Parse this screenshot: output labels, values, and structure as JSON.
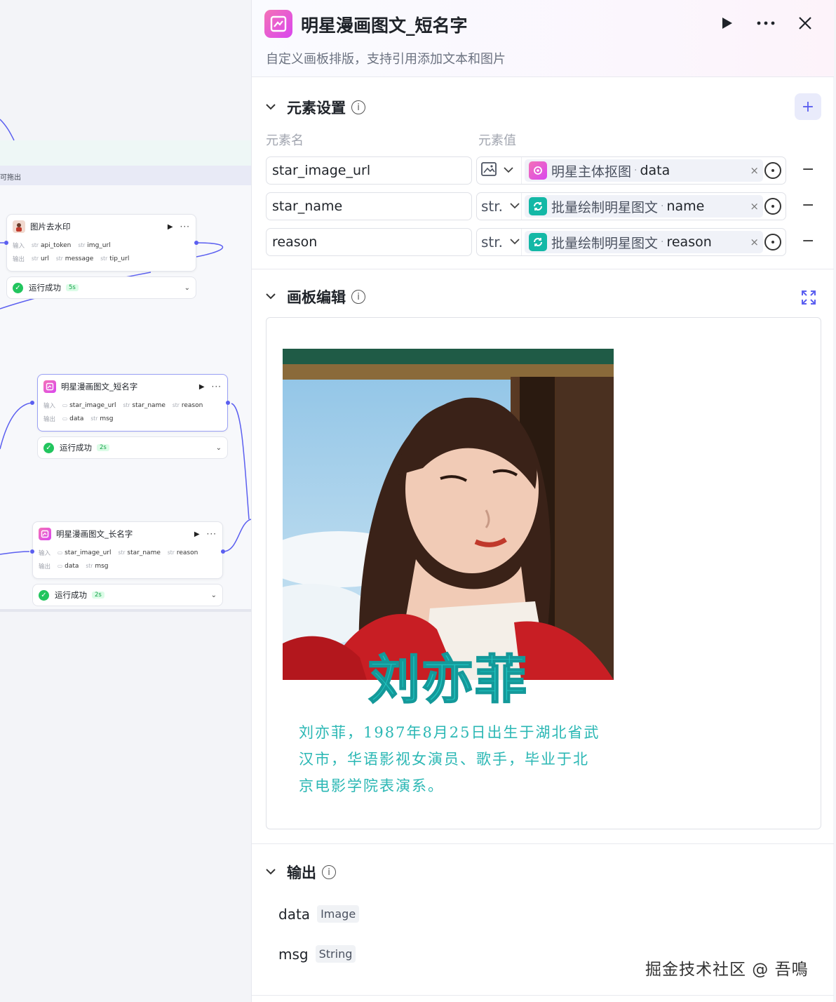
{
  "canvas": {
    "band_label": "可拖出",
    "nodes": [
      {
        "title": "图片去水印",
        "input_label": "输入",
        "inputs": [
          {
            "type": "str",
            "name": "api_token"
          },
          {
            "type": "str",
            "name": "img_url"
          }
        ],
        "output_label": "输出",
        "outputs": [
          {
            "type": "str",
            "name": "url"
          },
          {
            "type": "str",
            "name": "message"
          },
          {
            "type": "str",
            "name": "tip_url"
          }
        ],
        "status": "运行成功",
        "duration": "5s"
      },
      {
        "title": "明星漫画图文_短名字",
        "input_label": "输入",
        "inputs": [
          {
            "type": "img",
            "name": "star_image_url"
          },
          {
            "type": "str",
            "name": "star_name"
          },
          {
            "type": "str",
            "name": "reason"
          }
        ],
        "output_label": "输出",
        "outputs": [
          {
            "type": "img",
            "name": "data"
          },
          {
            "type": "str",
            "name": "msg"
          }
        ],
        "status": "运行成功",
        "duration": "2s"
      },
      {
        "title": "明星漫画图文_长名字",
        "input_label": "输入",
        "inputs": [
          {
            "type": "img",
            "name": "star_image_url"
          },
          {
            "type": "str",
            "name": "star_name"
          },
          {
            "type": "str",
            "name": "reason"
          }
        ],
        "output_label": "输出",
        "outputs": [
          {
            "type": "img",
            "name": "data"
          },
          {
            "type": "str",
            "name": "msg"
          }
        ],
        "status": "运行成功",
        "duration": "2s"
      }
    ]
  },
  "panel": {
    "title": "明星漫画图文_短名字",
    "description": "自定义画板排版，支持引用添加文本和图片",
    "run_icon": "play-icon",
    "more_icon": "more-icon",
    "close_icon": "close-icon",
    "elements_section": {
      "title": "元素设置",
      "col_name": "元素名",
      "col_value": "元素值",
      "add_icon": "plus-icon",
      "rows": [
        {
          "name": "star_image_url",
          "type": "image",
          "type_label": "",
          "ref_node": "明星主体抠图",
          "ref_field": "data",
          "ref_icon": "pink"
        },
        {
          "name": "star_name",
          "type": "str",
          "type_label": "str.",
          "ref_node": "批量绘制明星图文",
          "ref_field": "name",
          "ref_icon": "teal"
        },
        {
          "name": "reason",
          "type": "str",
          "type_label": "str.",
          "ref_node": "批量绘制明星图文",
          "ref_field": "reason",
          "ref_icon": "teal"
        }
      ]
    },
    "board_section": {
      "title": "画板编辑",
      "star_name_text": "刘亦菲",
      "reason_text": "刘亦菲，1987年8月25日出生于湖北省武汉市，华语影视女演员、歌手，毕业于北京电影学院表演系。"
    },
    "output_section": {
      "title": "输出",
      "outputs": [
        {
          "name": "data",
          "type": "Image"
        },
        {
          "name": "msg",
          "type": "String"
        }
      ]
    }
  },
  "watermark": "掘金技术社区 @ 吾鳴",
  "colors": {
    "accent": "#5b5ff0",
    "pink_icon": "#e45fc3",
    "teal_icon": "#14b8a6",
    "success": "#22c55e",
    "board_text": "#2ab7b4"
  }
}
